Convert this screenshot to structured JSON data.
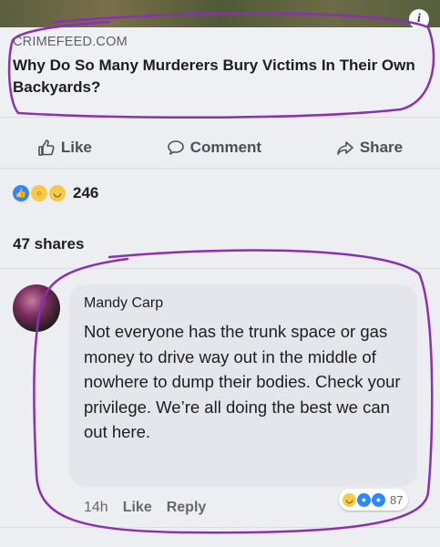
{
  "post": {
    "domain": "CRIMEFEED.COM",
    "headline": "Why Do So Many Murderers Bury Victims In Their Own Backyards?"
  },
  "actions": {
    "like": "Like",
    "comment": "Comment",
    "share": "Share"
  },
  "reactions": {
    "icons": [
      "like-icon",
      "wow-icon",
      "haha-icon"
    ],
    "count": "246"
  },
  "shares": "47 shares",
  "comment": {
    "author": "Mandy Carp",
    "text": "Not everyone has the trunk space or gas money to drive way out in the middle of nowhere to dump their bodies. Check your privilege. We’re all doing the best we can out here.",
    "time": "14h",
    "like": "Like",
    "reply": "Reply",
    "reaction_count": "87"
  },
  "colors": {
    "annotation": "#8b2fb3",
    "like_blue": "#2d88ff",
    "reaction_yellow": "#f7c948"
  }
}
